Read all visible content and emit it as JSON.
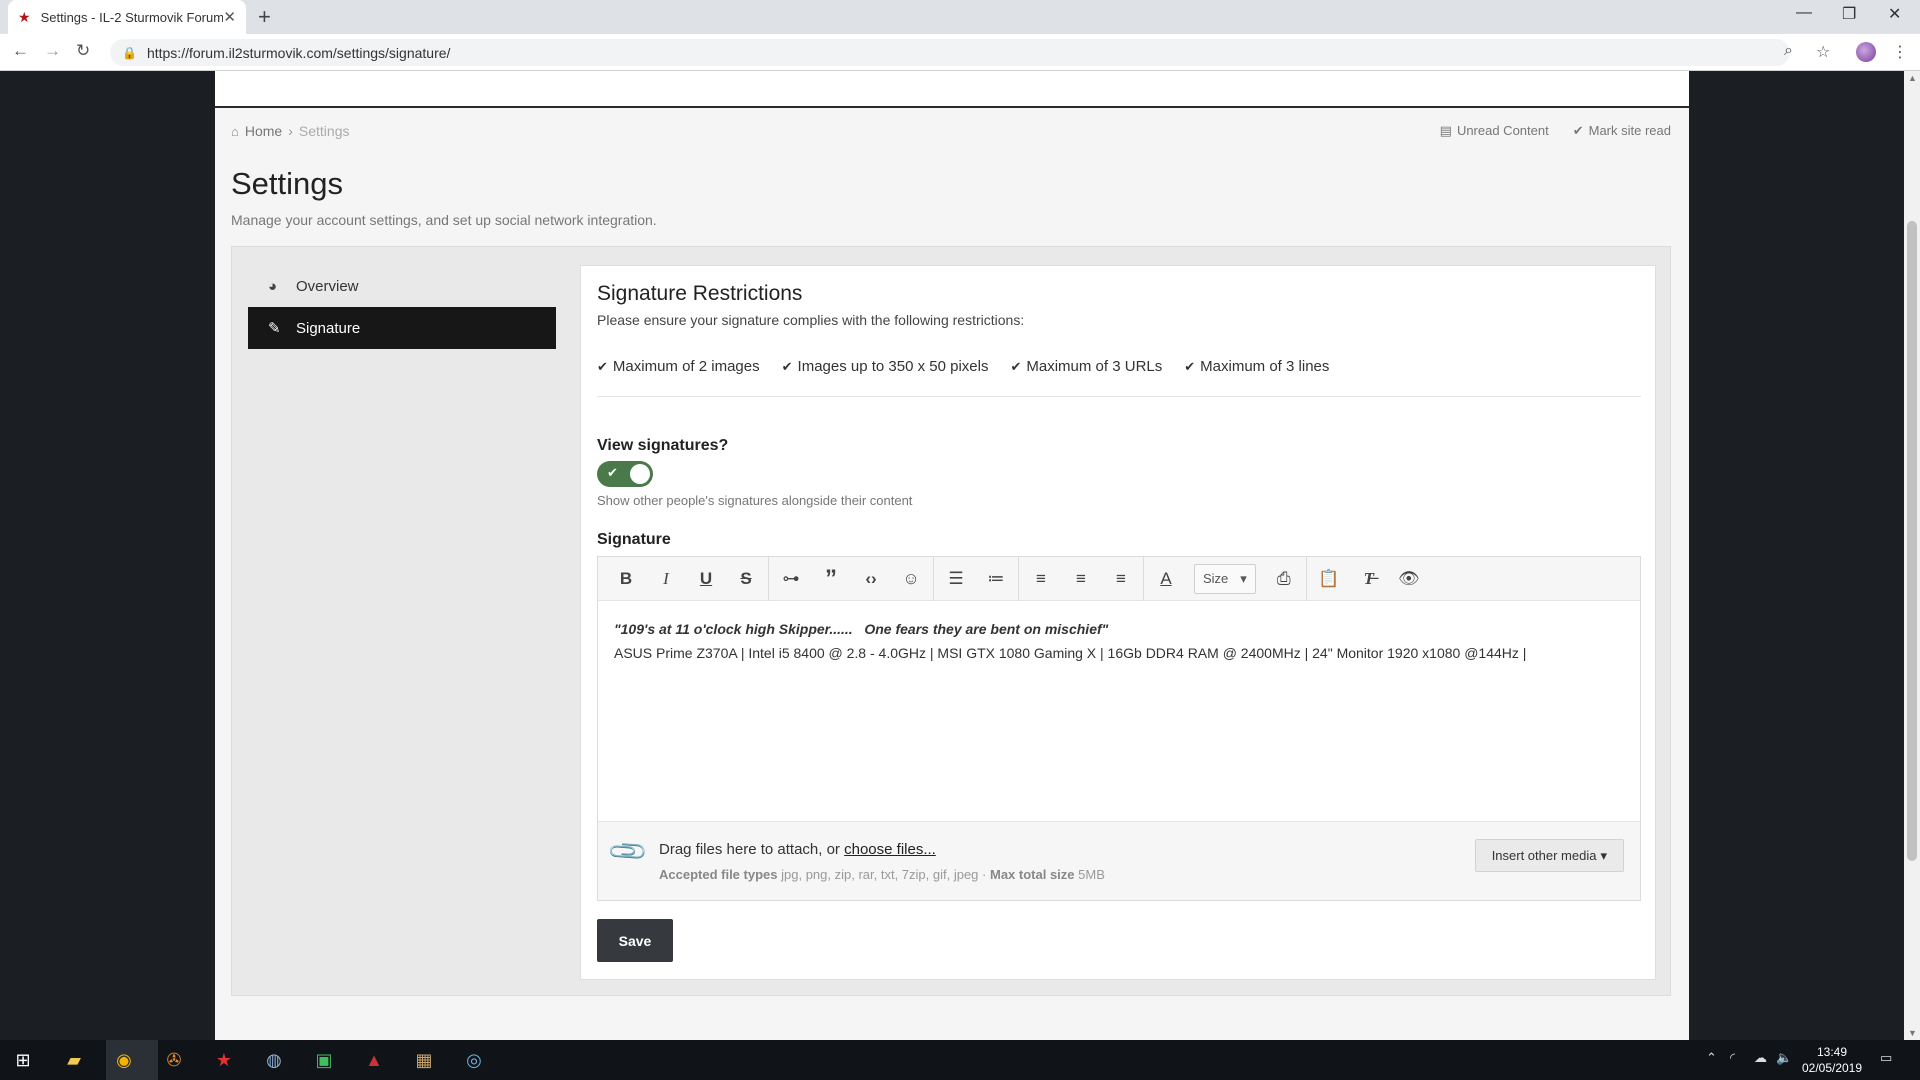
{
  "browser": {
    "tab_title": "Settings - IL-2 Sturmovik Forum",
    "url": "https://forum.il2sturmovik.com/settings/signature/"
  },
  "breadcrumb": {
    "home": "Home",
    "current": "Settings"
  },
  "top_links": {
    "unread": "Unread Content",
    "mark_read": "Mark site read"
  },
  "page": {
    "title": "Settings",
    "description": "Manage your account settings, and set up social network integration."
  },
  "sidebar": {
    "items": [
      {
        "label": "Overview",
        "icon": "dashboard-icon",
        "active": false
      },
      {
        "label": "Signature",
        "icon": "pencil-icon",
        "active": true
      }
    ]
  },
  "restrictions": {
    "title": "Signature Restrictions",
    "description": "Please ensure your signature complies with the following restrictions:",
    "items": [
      "Maximum of 2 images",
      "Images up to 350 x 50 pixels",
      "Maximum of 3 URLs",
      "Maximum of 3 lines"
    ]
  },
  "view_signatures": {
    "label": "View signatures?",
    "enabled": true,
    "help": "Show other people's signatures alongside their content"
  },
  "signature": {
    "label": "Signature",
    "toolbar": {
      "size_label": "Size"
    },
    "content_line1": "\"109's at 11 o'clock high Skipper......   One fears they are bent on mischief\"",
    "content_line2": "ASUS Prime Z370A | Intel i5 8400 @ 2.8 - 4.0GHz | MSI GTX 1080 Gaming X | 16Gb DDR4 RAM @ 2400MHz | 24\" Monitor 1920 x1080 @144Hz |"
  },
  "attachments": {
    "drag_text": "Drag files here to attach, or",
    "choose_link": "choose files...",
    "accepted_label": "Accepted file types",
    "accepted_types": "jpg, png, zip, rar, txt, 7zip, gif, jpeg",
    "max_label": "Max total size",
    "max_size": "5MB",
    "insert_button": "Insert other media"
  },
  "save_button": "Save",
  "taskbar": {
    "time": "13:49",
    "date": "02/05/2019"
  },
  "colors": {
    "active_nav": "#171717",
    "toggle_on": "#4a7a4a",
    "save_button": "#36393d"
  }
}
